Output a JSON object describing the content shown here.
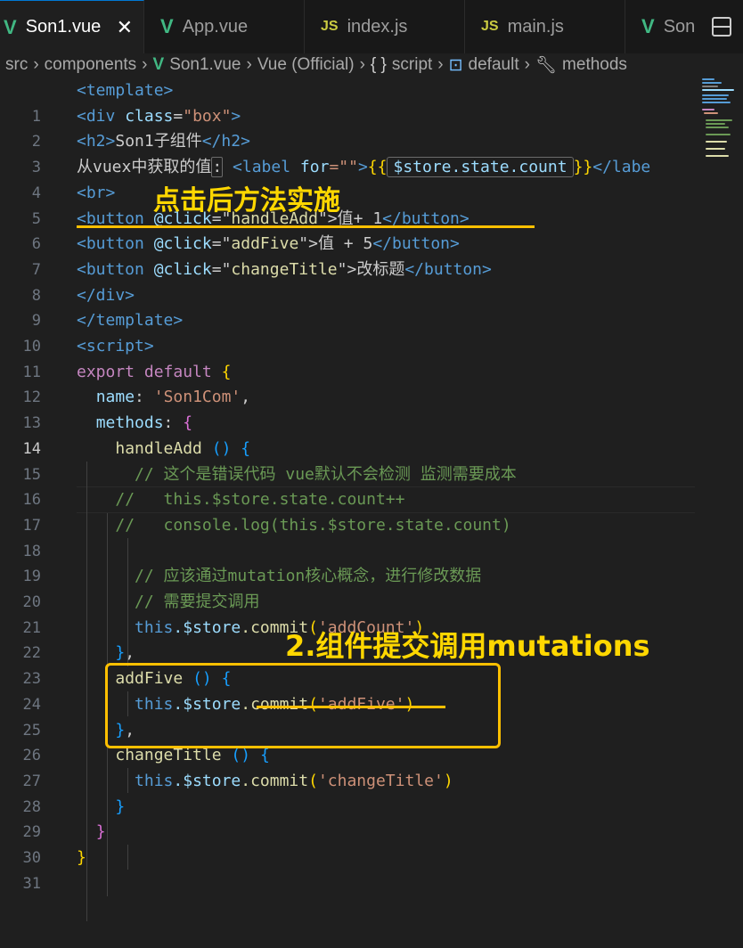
{
  "tabs": [
    {
      "label": "Son1.vue",
      "type": "vue",
      "active": true
    },
    {
      "label": "App.vue",
      "type": "vue"
    },
    {
      "label": "index.js",
      "type": "js",
      "badge": "JS"
    },
    {
      "label": "main.js",
      "type": "js",
      "badge": "JS"
    },
    {
      "label": "Son",
      "type": "vue"
    }
  ],
  "breadcrumb": {
    "src": "src",
    "components": "components",
    "file": "Son1.vue",
    "lang": "Vue (Official)",
    "script": "script",
    "default": "default",
    "methods": "methods"
  },
  "annotations": {
    "click_note": "点击后方法实施",
    "commit_note": "2.组件提交调用mutations"
  },
  "code": {
    "line_numbers": [
      "1",
      "2",
      "3",
      "4",
      "5",
      "6",
      "7",
      "8",
      "9",
      "10",
      "11",
      "12",
      "13",
      "14",
      "15",
      "16",
      "17",
      "18",
      "19",
      "20",
      "21",
      "22",
      "23",
      "24",
      "25",
      "26",
      "27",
      "28",
      "29",
      "30",
      "31"
    ],
    "l1": {
      "t": "<template>"
    },
    "l2": {
      "a": "<div",
      "b": "class",
      "c": "=",
      "d": "\"box\"",
      "e": ">"
    },
    "l3": {
      "a": "<h2>",
      "b": "Son1子组件",
      "c": "</h2>"
    },
    "l4": {
      "a": "从vuex中获取的值",
      "b": ":",
      "c": "<label",
      "d": "for",
      "e": "=\"\"",
      "f": ">",
      "g": "{{",
      "h": "$store.state.count",
      "i": "}}",
      "j": "</labe"
    },
    "l5": {
      "t": "<br>"
    },
    "l6": {
      "a": "<button",
      "b": "@click",
      "c": "=\"",
      "d": "handleAdd",
      "e": "\">",
      "f": "值+ 1",
      "g": "</button>"
    },
    "l7": {
      "a": "<button",
      "b": "@click",
      "c": "=\"",
      "d": "addFive",
      "e": "\">",
      "f": "值 + 5",
      "g": "</button>"
    },
    "l8": {
      "a": "<button",
      "b": "@click",
      "c": "=\"",
      "d": "changeTitle",
      "e": "\">",
      "f": "改标题",
      "g": "</button>"
    },
    "l9": {
      "t": "</div>"
    },
    "l10": {
      "t": "</template>"
    },
    "l11": {
      "t": "<script>"
    },
    "l12": {
      "a": "export",
      "b": "default",
      "c": "{"
    },
    "l13": {
      "a": "name",
      "b": ": ",
      "c": "'Son1Com'",
      "d": ","
    },
    "l14": {
      "a": "methods",
      "b": ": ",
      "c": "{"
    },
    "l15": {
      "a": "handleAdd",
      "b": " ",
      "c": "()",
      "d": " ",
      "e": "{"
    },
    "l16": {
      "t": "// 这个是错误代码 vue默认不会检测 监测需要成本"
    },
    "l17": {
      "t": "//   this.$store.state.count++"
    },
    "l18": {
      "t": "//   console.log(this.$store.state.count)"
    },
    "l20": {
      "t": "// 应该通过mutation核心概念，进行修改数据"
    },
    "l21": {
      "t": "// 需要提交调用"
    },
    "l22": {
      "a": "this",
      "b": ".$store",
      "c": ".commit",
      "d": "(",
      "e": "'addCount'",
      "f": ")"
    },
    "l23": {
      "a": "}",
      "b": ","
    },
    "l24": {
      "a": "addFive",
      "b": " ",
      "c": "()",
      "d": " ",
      "e": "{"
    },
    "l25": {
      "a": "this",
      "b": ".$store",
      "c": ".commit",
      "d": "(",
      "e": "'addFive'",
      "f": ")"
    },
    "l26": {
      "a": "}",
      "b": ","
    },
    "l27": {
      "a": "changeTitle",
      "b": " ",
      "c": "()",
      "d": " ",
      "e": "{"
    },
    "l28": {
      "a": "this",
      "b": ".$store",
      "c": ".commit",
      "d": "(",
      "e": "'changeTitle'",
      "f": ")"
    },
    "l29": {
      "t": "}"
    },
    "l30": {
      "t": "}"
    },
    "l31": {
      "t": "}"
    }
  }
}
